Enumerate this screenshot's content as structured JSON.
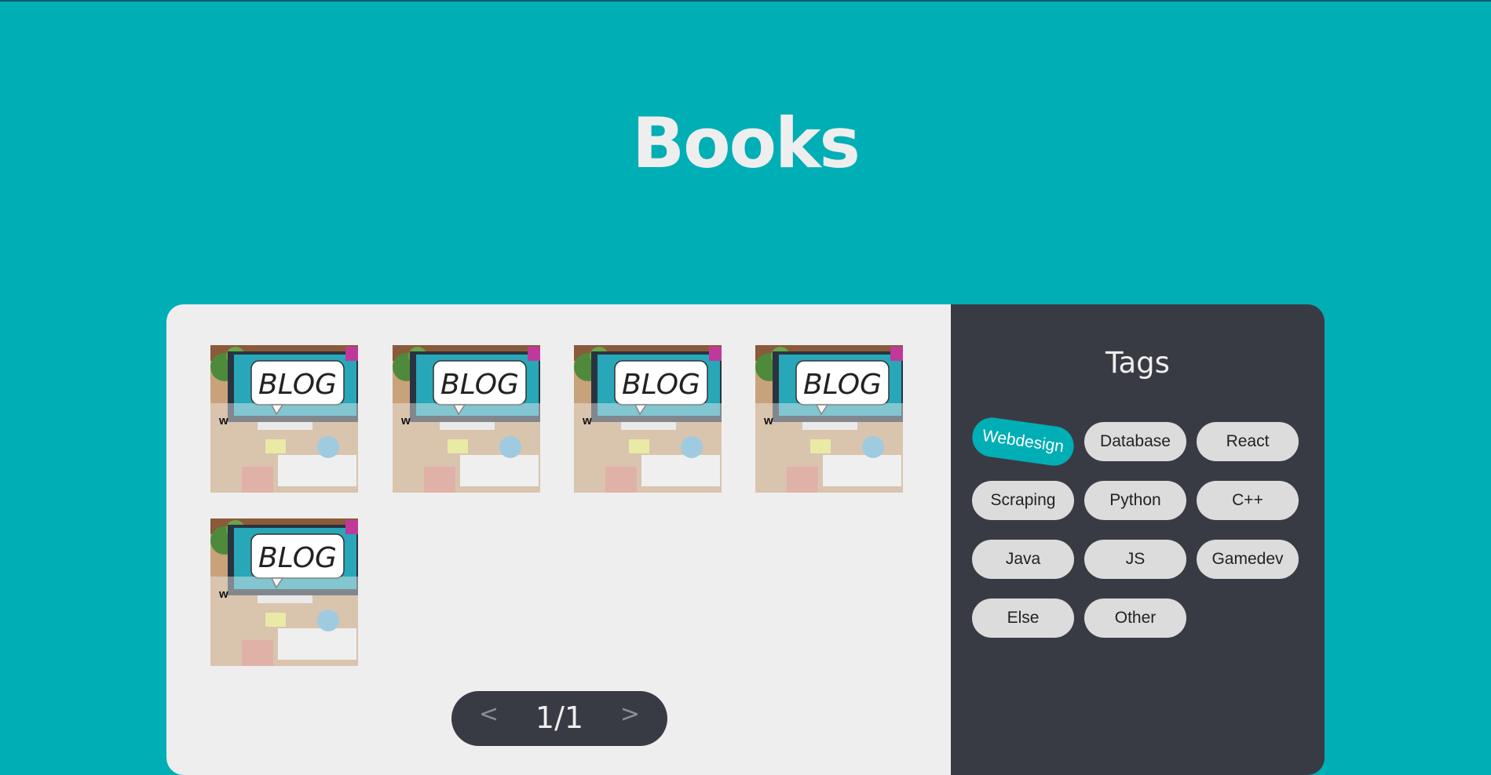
{
  "page": {
    "title": "Books"
  },
  "books": [
    {
      "letter": "w",
      "thumbnail_text": "BLOG"
    },
    {
      "letter": "w",
      "thumbnail_text": "BLOG"
    },
    {
      "letter": "w",
      "thumbnail_text": "BLOG"
    },
    {
      "letter": "w",
      "thumbnail_text": "BLOG"
    },
    {
      "letter": "w",
      "thumbnail_text": "BLOG"
    }
  ],
  "pagination": {
    "prev_label": "<",
    "next_label": ">",
    "page_text": "1/1"
  },
  "tags": {
    "title": "Tags",
    "items": [
      {
        "label": "Webdesign",
        "active": true
      },
      {
        "label": "Database",
        "active": false
      },
      {
        "label": "React",
        "active": false
      },
      {
        "label": "Scraping",
        "active": false
      },
      {
        "label": "Python",
        "active": false
      },
      {
        "label": "C++",
        "active": false
      },
      {
        "label": "Java",
        "active": false
      },
      {
        "label": "JS",
        "active": false
      },
      {
        "label": "Gamedev",
        "active": false
      },
      {
        "label": "Else",
        "active": false
      },
      {
        "label": "Other",
        "active": false
      }
    ]
  },
  "colors": {
    "background": "#00aeb5",
    "panel_light": "#eeeeee",
    "panel_dark": "#393b44",
    "accent": "#00aeb5",
    "tag_bg": "#dcdcdc"
  }
}
